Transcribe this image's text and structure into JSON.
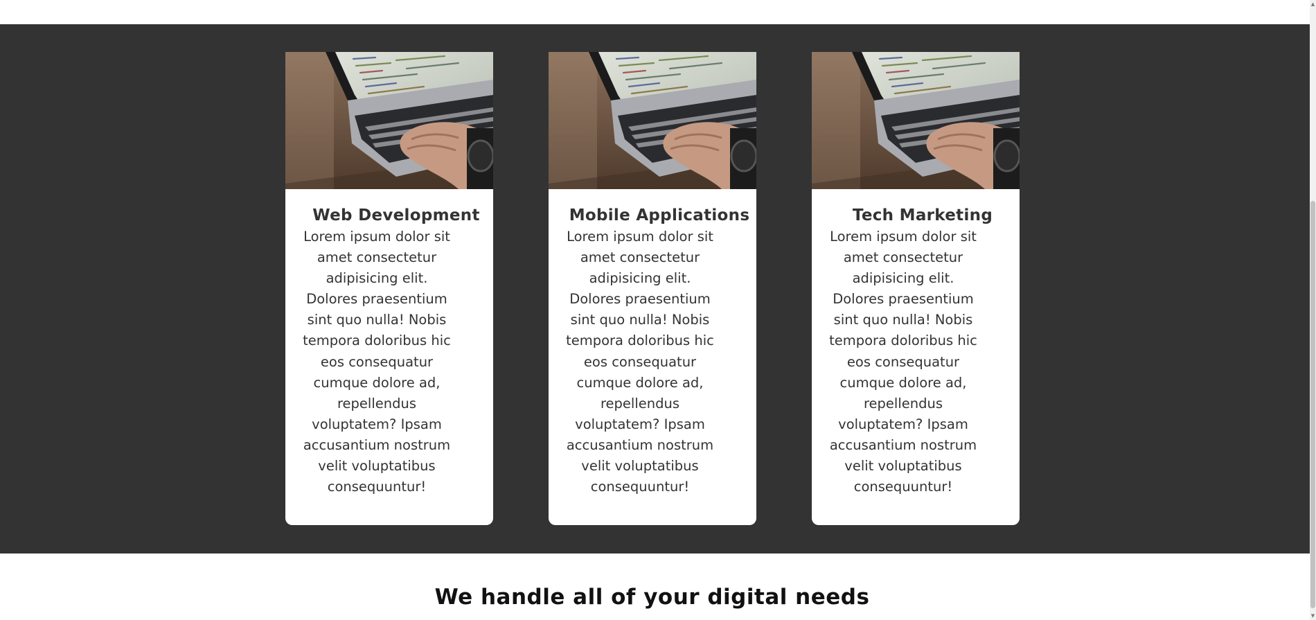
{
  "services": {
    "cards": [
      {
        "title": "Web Development",
        "text": "Lorem ipsum dolor sit amet consectetur adipisicing elit. Dolores praesentium sint quo nulla! Nobis tempora doloribus hic eos consequatur cumque dolore ad, repellendus voluptatem? Ipsam accusantium nostrum velit voluptatibus consequuntur!"
      },
      {
        "title": "Mobile Applications",
        "text": "Lorem ipsum dolor sit amet consectetur adipisicing elit. Dolores praesentium sint quo nulla! Nobis tempora doloribus hic eos consequatur cumque dolore ad, repellendus voluptatem? Ipsam accusantium nostrum velit voluptatibus consequuntur!"
      },
      {
        "title": "Tech Marketing",
        "text": "Lorem ipsum dolor sit amet consectetur adipisicing elit. Dolores praesentium sint quo nulla! Nobis tempora doloribus hic eos consequatur cumque dolore ad, repellendus voluptatem? Ipsam accusantium nostrum velit voluptatibus consequuntur!"
      }
    ]
  },
  "intro": {
    "heading": "We handle all of your digital needs"
  },
  "colors": {
    "section_background": "#333333",
    "card_background": "#ffffff",
    "text": "#333333"
  }
}
